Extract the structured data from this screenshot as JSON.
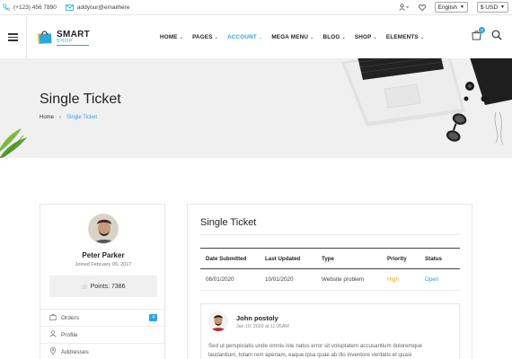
{
  "topbar": {
    "phone": "(+123) 456 7890",
    "email": "addyour@emailhere",
    "language": "English",
    "currency": "$ USD"
  },
  "header": {
    "logo_main": "SMART",
    "logo_sub": "SHOP",
    "cart_count": "0",
    "nav": [
      {
        "label": "HOME"
      },
      {
        "label": "PAGES"
      },
      {
        "label": "ACCOUNT"
      },
      {
        "label": "MEGA MENU"
      },
      {
        "label": "BLOG"
      },
      {
        "label": "SHOP"
      },
      {
        "label": "ELEMENTS"
      }
    ]
  },
  "banner": {
    "title": "Single Ticket",
    "breadcrumb_home": "Home",
    "breadcrumb_current": "Single Ticket"
  },
  "profile": {
    "name": "Peter Parker",
    "joined": "Joined February 06, 2017",
    "points": "Points: 7386",
    "menu": [
      {
        "label": "Orders",
        "count": "4",
        "icon": "bag-icon"
      },
      {
        "label": "Profile",
        "icon": "user-icon"
      },
      {
        "label": "Addresses",
        "icon": "map-pin-icon"
      }
    ]
  },
  "ticket": {
    "title": "Single Ticket",
    "columns": [
      "Date Submitted",
      "Last Updated",
      "Type",
      "Priority",
      "Status"
    ],
    "row": {
      "submitted": "08/01/2020",
      "updated": "10/01/2020",
      "type": "Website problem",
      "priority": "High",
      "status": "Open"
    },
    "comment": {
      "author": "John postoly",
      "date": "Jan 10, 2020 at 11:05AM",
      "text": "Sed ut perspiciatis unde omnis iste natus error sit voluptatem accusantium doloremque laudantium, totam rem aperiam, eaque ipsa quae ab illo inventore veritatis et quasi"
    }
  },
  "colors": {
    "accent": "#2aa7e0",
    "priority_high": "#f5a623"
  }
}
